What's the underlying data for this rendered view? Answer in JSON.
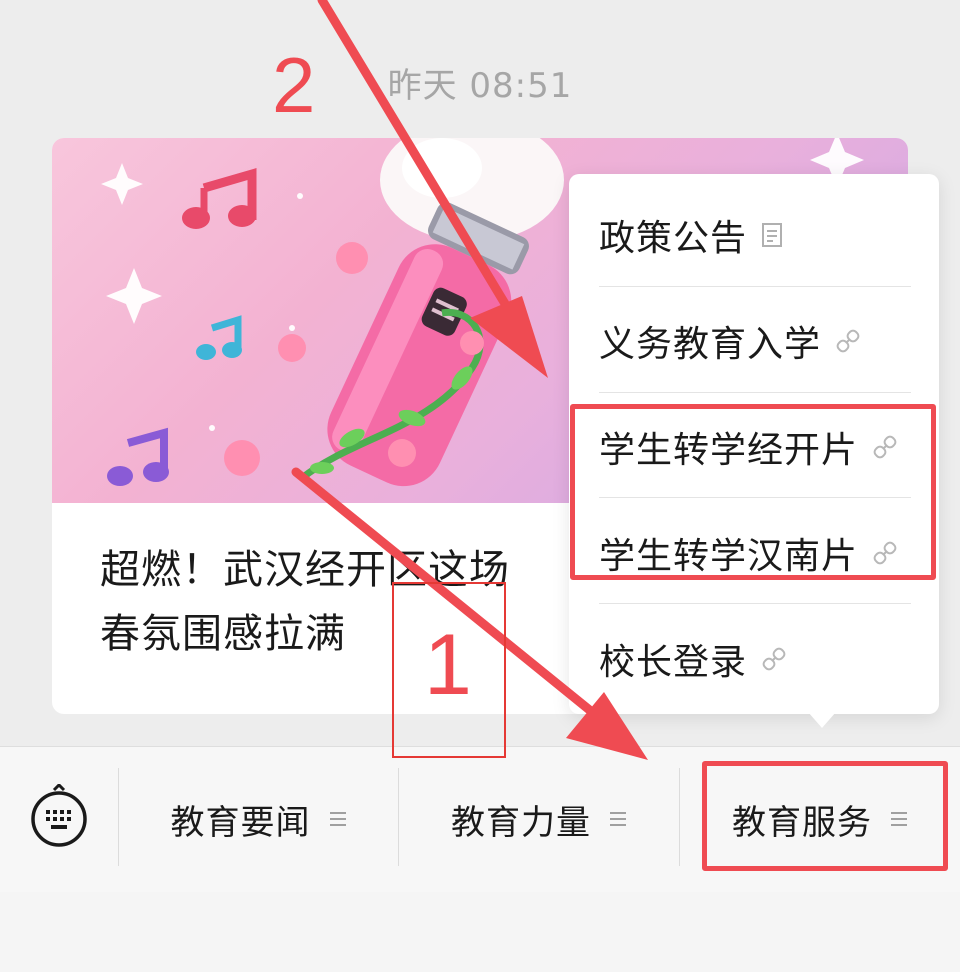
{
  "timestamp": "昨天 08:51",
  "article": {
    "title": "超燃！武汉经开区这场校园歌手大赛青春氛围感拉满",
    "title_line1": "超燃！武汉经开区这场",
    "title_line2": "春氛围感拉满"
  },
  "submenu": {
    "items": [
      {
        "label": "政策公告",
        "icon": "document-icon"
      },
      {
        "label": "义务教育入学",
        "icon": "link-icon"
      },
      {
        "label": "学生转学经开片",
        "icon": "link-icon"
      },
      {
        "label": "学生转学汉南片",
        "icon": "link-icon"
      },
      {
        "label": "校长登录",
        "icon": "link-icon"
      }
    ]
  },
  "bottom_menu": {
    "keyboard_icon": "keyboard-icon",
    "tabs": [
      {
        "label": "教育要闻",
        "icon": "menu-lines-icon"
      },
      {
        "label": "教育力量",
        "icon": "menu-lines-icon"
      },
      {
        "label": "教育服务",
        "icon": "menu-lines-icon"
      }
    ]
  },
  "annotations": {
    "step1": "1",
    "step2": "2",
    "color": "#ef4b52"
  }
}
